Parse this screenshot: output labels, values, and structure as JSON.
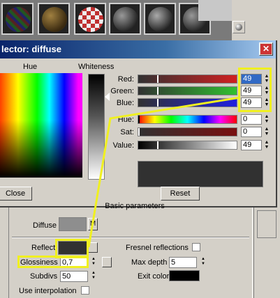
{
  "dialog": {
    "title": "lector: diffuse",
    "close_glyph": "✕",
    "hue_label": "Hue",
    "whiteness_label": "Whiteness",
    "rows": [
      {
        "label": "Red:",
        "value": "49"
      },
      {
        "label": "Green:",
        "value": "49"
      },
      {
        "label": "Blue:",
        "value": "49"
      },
      {
        "label": "Hue:",
        "value": "0"
      },
      {
        "label": "Sat:",
        "value": "0"
      },
      {
        "label": "Value:",
        "value": "49"
      }
    ],
    "close_button": "Close",
    "reset_button": "Reset",
    "preview_color": "#313131"
  },
  "panel": {
    "rollout_title": "Basic parameters",
    "diffuse_label": "Diffuse",
    "diffuse_map_btn": "M",
    "reflect_label": "Reflect",
    "fresnel_label": "Fresnel reflections",
    "glossiness_label": "Glossiness",
    "glossiness_value": "0,7",
    "max_depth_label": "Max depth",
    "max_depth_value": "5",
    "subdivs_label": "Subdivs",
    "subdivs_value": "50",
    "exit_color_label": "Exit color",
    "use_interp_label": "Use interpolation"
  },
  "colors": {
    "highlight": "#f0f020",
    "title_bar": "#0a246a"
  }
}
